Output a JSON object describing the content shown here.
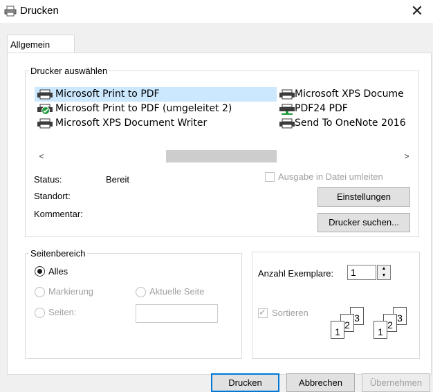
{
  "window": {
    "title": "Drucken",
    "icon": "printer-icon",
    "close_glyph": "✕"
  },
  "tabs": [
    {
      "label": "Allgemein"
    }
  ],
  "printer_group": {
    "legend": "Drucker auswählen",
    "printers_col1": [
      {
        "name": "Microsoft Print to PDF",
        "selected": true
      },
      {
        "name": "Microsoft Print to PDF (umgeleitet 2)",
        "default": true
      },
      {
        "name": "Microsoft XPS Document Writer"
      }
    ],
    "printers_col2": [
      {
        "name": "Microsoft XPS Docume"
      },
      {
        "name": "PDF24 PDF"
      },
      {
        "name": "Send To OneNote 2016"
      }
    ],
    "scroll_left": "<",
    "scroll_right": ">",
    "status_label": "Status:",
    "status_value": "Bereit",
    "location_label": "Standort:",
    "comment_label": "Kommentar:",
    "print_to_file_label": "Ausgabe in Datei umleiten",
    "settings_button": "Einstellungen",
    "find_printer_button": "Drucker suchen..."
  },
  "page_range": {
    "legend": "Seitenbereich",
    "all_label": "Alles",
    "selection_label": "Markierung",
    "current_page_label": "Aktuelle Seite",
    "pages_label": "Seiten:"
  },
  "copies": {
    "label": "Anzahl Exemplare:",
    "value": "1",
    "collate_label": "Sortieren",
    "collate_pages": [
      "1",
      "2",
      "3"
    ]
  },
  "footer": {
    "print_button": "Drucken",
    "cancel_button": "Abbrechen",
    "apply_button": "Übernehmen"
  },
  "colors": {
    "selection": "#cce8ff",
    "accent": "#0078d7",
    "disabled_text": "#a0a0a0"
  }
}
